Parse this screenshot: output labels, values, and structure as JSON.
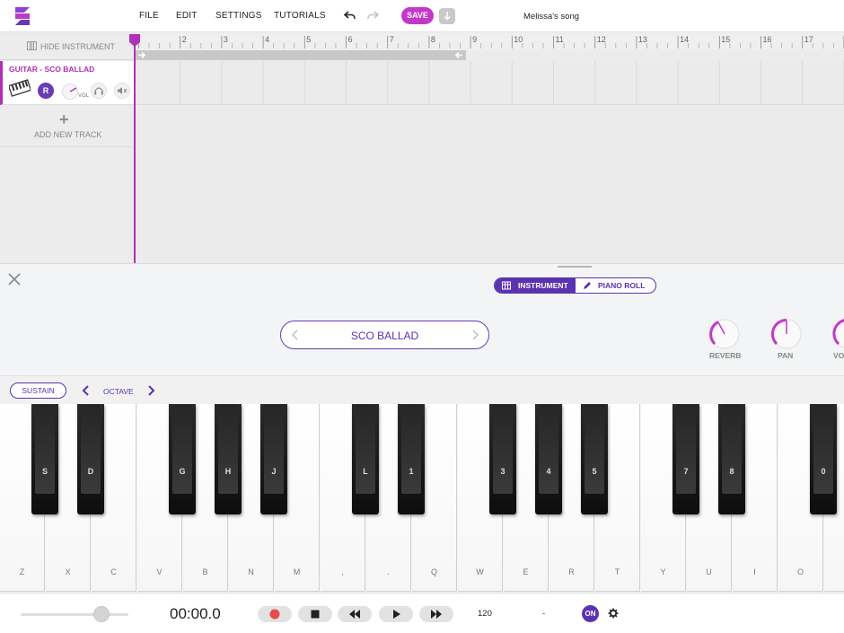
{
  "menubar": {
    "items": [
      "FILE",
      "EDIT",
      "SETTINGS",
      "TUTORIALS"
    ],
    "save_label": "SAVE",
    "song_title": "Melissa's song"
  },
  "track_area": {
    "hide_instrument_label": "HIDE INSTRUMENT",
    "ruler_numbers": [
      "2",
      "3",
      "4",
      "5",
      "6",
      "7",
      "8",
      "9",
      "10",
      "11",
      "12",
      "13",
      "14",
      "15",
      "16",
      "17"
    ],
    "tracks": [
      {
        "name": "GUITAR - SCO BALLAD",
        "record_label": "R",
        "volume_label": "VOL"
      }
    ],
    "add_track_label": "ADD NEW TRACK"
  },
  "panel": {
    "mode_instrument": "INSTRUMENT",
    "mode_piano_roll": "PIANO ROLL",
    "active_mode": "INSTRUMENT",
    "preset_name": "SCO BALLAD",
    "knobs": [
      {
        "label": "REVERB"
      },
      {
        "label": "PAN"
      },
      {
        "label": "VO"
      }
    ],
    "sustain_label": "SUSTAIN",
    "octave_label": "OCTAVE"
  },
  "keyboard": {
    "white_keys": [
      "Z",
      "X",
      "C",
      "V",
      "B",
      "N",
      "M",
      ",",
      ".",
      "Q",
      "W",
      "E",
      "R",
      "T",
      "Y",
      "U",
      "I",
      "O",
      ""
    ],
    "black_keys": [
      "S",
      "D",
      "G",
      "H",
      "J",
      "L",
      "1",
      "3",
      "4",
      "5",
      "7",
      "8",
      "0"
    ]
  },
  "transport": {
    "time": "00:00.0",
    "tempo": "120",
    "key_display": "-",
    "metronome_label": "ON"
  },
  "colors": {
    "accent_purple": "#5b33b0",
    "brand_magenta": "#c338c9",
    "record_red": "#e84b4b"
  }
}
